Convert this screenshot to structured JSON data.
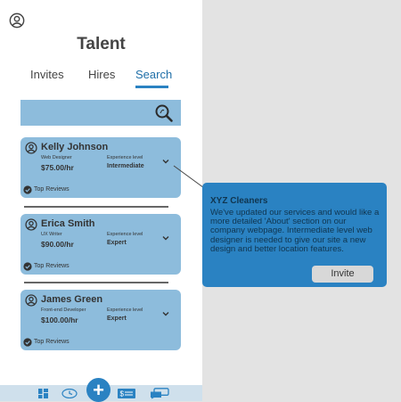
{
  "header": {
    "title": "Talent"
  },
  "tabs": [
    {
      "label": "Invites"
    },
    {
      "label": "Hires"
    },
    {
      "label": "Search",
      "active": true
    }
  ],
  "search": {
    "icon": "search-icon"
  },
  "candidates": [
    {
      "name": "Kelly Johnson",
      "role": "Web Designer",
      "rate": "$75.00/hr",
      "experience_label": "Experience level",
      "experience_value": "Intermediate",
      "reviews": "Top Reviews"
    },
    {
      "name": "Erica Smith",
      "role": "UX Writer",
      "rate": "$90.00/hr",
      "experience_label": "Experience level",
      "experience_value": "Expert",
      "reviews": "Top Reviews"
    },
    {
      "name": "James Green",
      "role": "Front-end Developer",
      "rate": "$100.00/hr",
      "experience_label": "Experience level",
      "experience_value": "Expert",
      "reviews": "Top Reviews"
    }
  ],
  "popup": {
    "company": "XYZ Cleaners",
    "message": "We've updated our services and would like a more detailed 'About' section on our company webpage. Intermediate level web designer is needed to give our site a new design and better location features.",
    "invite_label": "Invite"
  },
  "bottom_nav": {
    "fab_label": "+",
    "items": [
      "dashboard-icon",
      "clock-icon",
      "add-icon",
      "payment-icon",
      "messages-icon"
    ]
  },
  "colors": {
    "accent": "#2a82c2",
    "card": "#8dbcdc",
    "background": "#e3e3e3",
    "popup": "#2a82c2"
  }
}
